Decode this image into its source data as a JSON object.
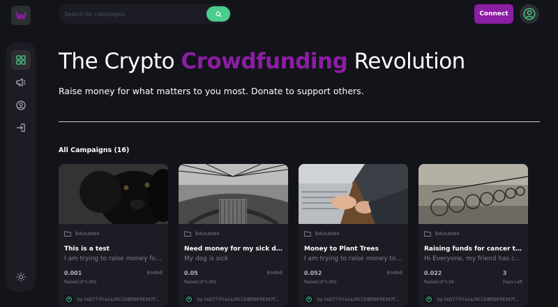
{
  "colors": {
    "background": "#13131a",
    "surface": "#1c1c24",
    "accent_purple": "#8c1ea3",
    "accent_green": "#4acd8d",
    "muted": "#808191"
  },
  "header": {
    "search_placeholder": "Search for campaigns",
    "connect_label": "Connect"
  },
  "sidebar": {
    "icons": [
      "dashboard-icon",
      "campaign-megaphone-icon",
      "profile-icon",
      "logout-icon"
    ],
    "bottom_icon": "theme-sun-icon"
  },
  "hero": {
    "title_before": "The Crypto ",
    "title_accent": "Crowdfunding",
    "title_after": " Revolution",
    "subtitle": "Raise money for what matters to you most. Donate to support others."
  },
  "campaigns": {
    "heading": "All Campaigns (16)",
    "items": [
      {
        "category": "Education",
        "title": "This is a test",
        "description": "I am trying to raise money for a project",
        "amount": "0.001",
        "raised_of": "Raised of 0.001",
        "status": "Ended",
        "status_sub": "",
        "owner": "by 0xD777Fce1a29CC0d85bF5B397F...",
        "image": "black-dog"
      },
      {
        "category": "Education",
        "title": "Need money for my sick dog",
        "description": "My dog is sick",
        "amount": "0.05",
        "raised_of": "Raised of 0.001",
        "status": "Ended",
        "status_sub": "",
        "owner": "by 0xD777Fce1a29CC0d85bF5B397F...",
        "image": "city-skyline"
      },
      {
        "category": "Education",
        "title": "Money to Plant Trees",
        "description": "I am trying to raise money to plant trees",
        "amount": "0.052",
        "raised_of": "Raised of 0.002",
        "status": "Ended",
        "status_sub": "",
        "owner": "by 0xD777Fce1a29CC0d85bF5B397F...",
        "image": "laptop-typing"
      },
      {
        "category": "Education",
        "title": "Raising funds for cancer treatment",
        "description": "Hi Everyone, my friend has cancer",
        "amount": "0.022",
        "raised_of": "Raised of 0.04",
        "status": "3",
        "status_sub": "Days Left",
        "owner": "by 0xD777Fce1a29CC0d85bF5B397F...",
        "image": "bicycles"
      }
    ]
  }
}
